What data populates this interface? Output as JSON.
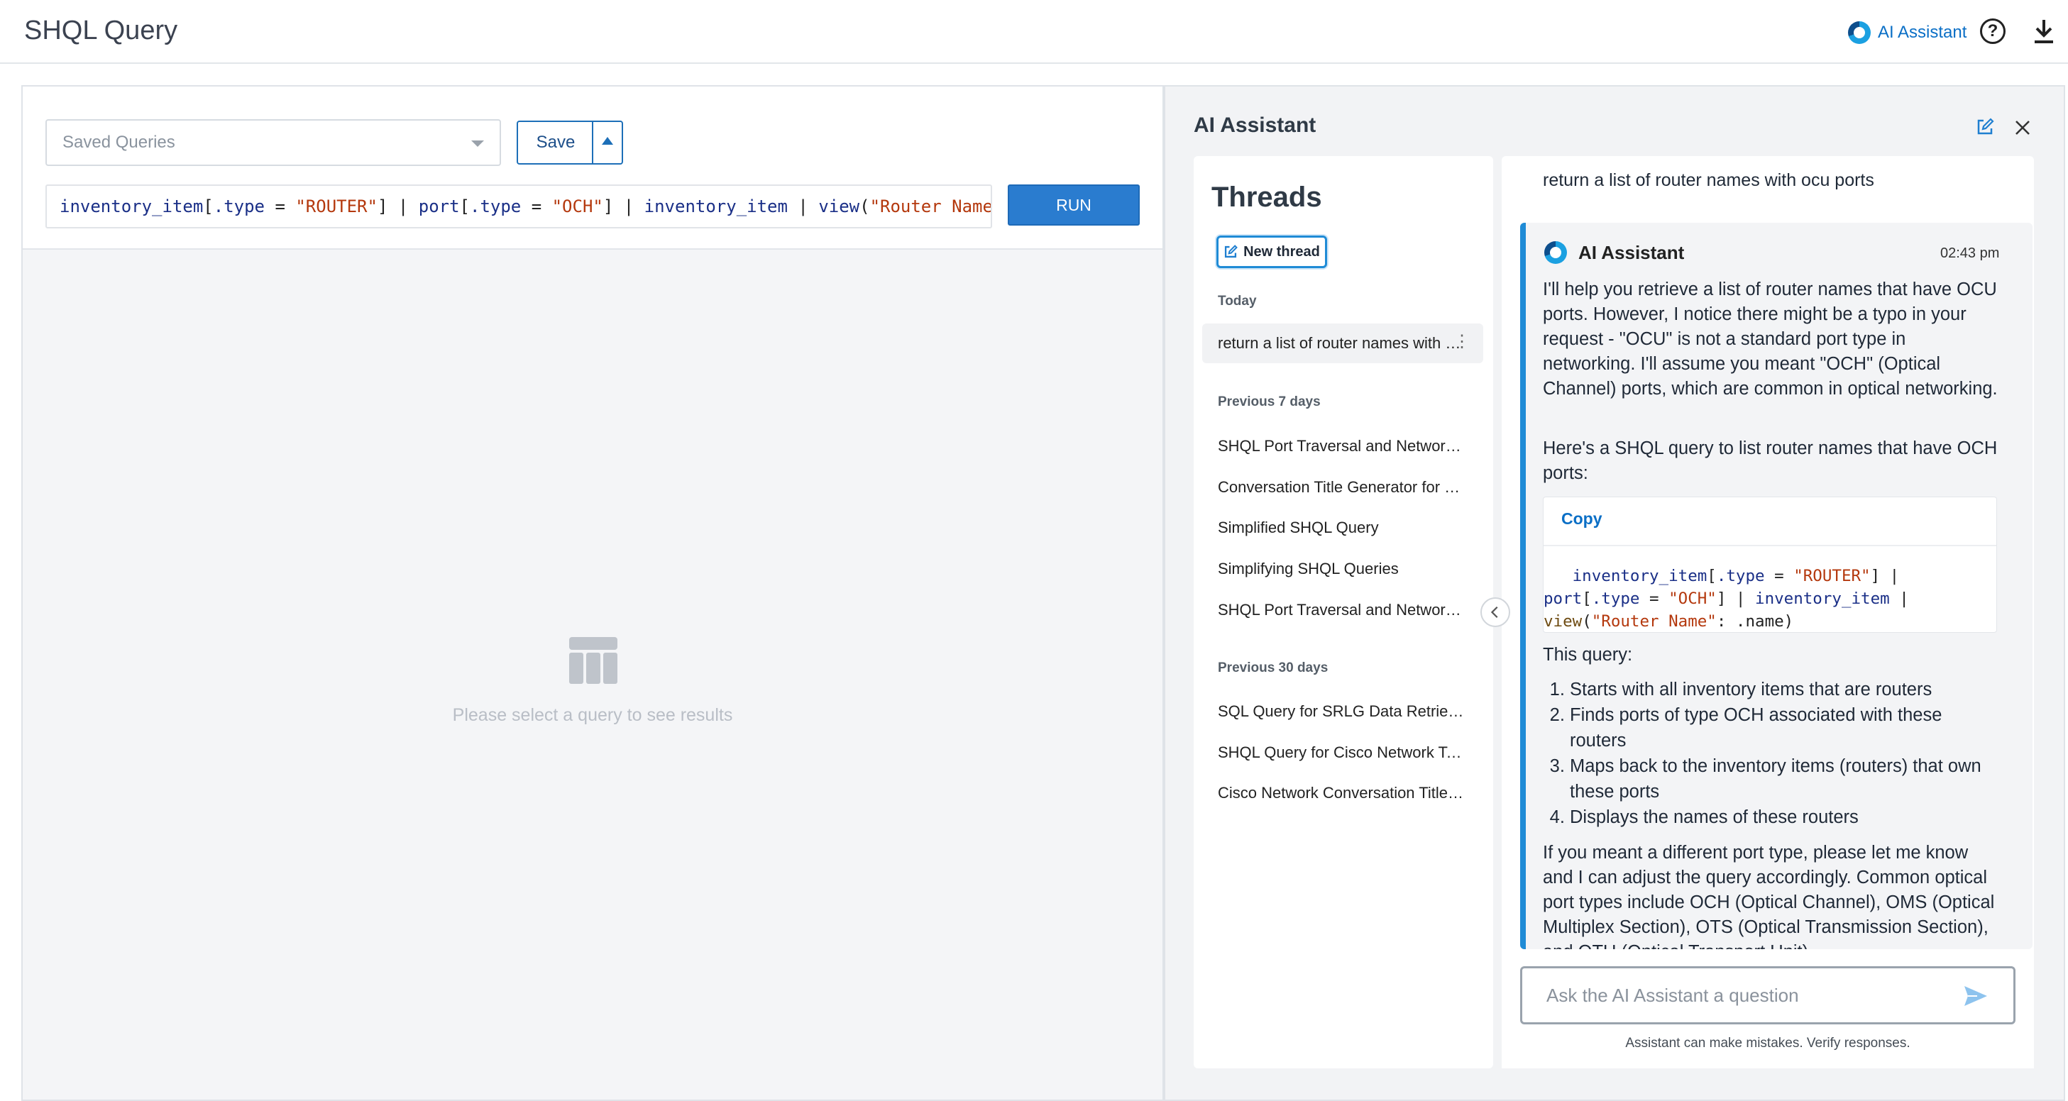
{
  "app": {
    "title": "SHQL Query",
    "ai_link": "AI Assistant"
  },
  "query": {
    "saved_placeholder": "Saved Queries",
    "save_label": "Save",
    "run_label": "RUN",
    "tokens": [
      {
        "t": "inventory_item",
        "c": "k-id"
      },
      {
        "t": "[",
        "c": "k-op"
      },
      {
        "t": ".type",
        "c": "k-id"
      },
      {
        "t": " = ",
        "c": "k-op"
      },
      {
        "t": "\"ROUTER\"",
        "c": "k-str"
      },
      {
        "t": "] | ",
        "c": "k-op"
      },
      {
        "t": "port",
        "c": "k-id"
      },
      {
        "t": "[",
        "c": "k-op"
      },
      {
        "t": ".type",
        "c": "k-id"
      },
      {
        "t": " = ",
        "c": "k-op"
      },
      {
        "t": "\"OCH\"",
        "c": "k-str"
      },
      {
        "t": "] | ",
        "c": "k-op"
      },
      {
        "t": "inventory_item",
        "c": "k-id"
      },
      {
        "t": " | ",
        "c": "k-op"
      },
      {
        "t": "view",
        "c": "k-id"
      },
      {
        "t": "(",
        "c": "k-op"
      },
      {
        "t": "\"Router Name\"",
        "c": "k-str"
      },
      {
        "t": ": ",
        "c": "k-op"
      },
      {
        "t": ".name",
        "c": "k-id"
      },
      {
        "t": ")",
        "c": "k-op"
      }
    ],
    "empty_message": "Please select a query to see results"
  },
  "assistant": {
    "panel_title": "AI Assistant",
    "threads": {
      "title": "Threads",
      "new_thread_label": "New thread",
      "today_label": "Today",
      "today": [
        "return a list of router names with ocu ports"
      ],
      "week_label": "Previous 7 days",
      "week": [
        "SHQL Port Traversal and Network Inventory",
        "Conversation Title Generator for Network",
        "Simplified SHQL Query",
        "Simplifying SHQL Queries",
        "SHQL Port Traversal and Network Inventory"
      ],
      "month_label": "Previous 30 days",
      "month": [
        "SQL Query for SRLG Data Retrieval",
        "SHQL Query for Cisco Network Topology",
        "Cisco Network Conversation Title Generator"
      ]
    },
    "chat": {
      "user_message": "return a list of router names with ocu ports",
      "response_author": "AI Assistant",
      "response_time": "02:43 pm",
      "para1": "I'll help you retrieve a list of router names that have OCU ports. However, I notice there might be a typo in your request - \"OCU\" is not a standard port type in networking. I'll assume you meant \"OCH\" (Optical Channel) ports, which are common in optical networking.",
      "para2": "Here's a SHQL query to list router names that have OCH ports:",
      "copy_label": "Copy",
      "code_lines": [
        [
          {
            "t": "   inventory_item",
            "c": "k-id"
          },
          {
            "t": "[",
            "c": "k-op"
          },
          {
            "t": ".type",
            "c": "k-id"
          },
          {
            "t": " = ",
            "c": "k-op"
          },
          {
            "t": "\"ROUTER\"",
            "c": "k-str"
          },
          {
            "t": "] |",
            "c": "k-op"
          }
        ],
        [
          {
            "t": "port",
            "c": "k-id"
          },
          {
            "t": "[",
            "c": "k-op"
          },
          {
            "t": ".type",
            "c": "k-id"
          },
          {
            "t": " = ",
            "c": "k-op"
          },
          {
            "t": "\"OCH\"",
            "c": "k-str"
          },
          {
            "t": "] | ",
            "c": "k-op"
          },
          {
            "t": "inventory_item",
            "c": "k-id"
          },
          {
            "t": " |",
            "c": "k-op"
          }
        ],
        [
          {
            "t": "view",
            "c": "k-fn"
          },
          {
            "t": "(",
            "c": "k-op"
          },
          {
            "t": "\"Router Name\"",
            "c": "k-str"
          },
          {
            "t": ": .name)",
            "c": "k-op"
          }
        ]
      ],
      "para3": "This query:",
      "steps": [
        "Starts with all inventory items that are routers",
        "Finds ports of type OCH associated with these routers",
        "Maps back to the inventory items (routers) that own these ports",
        "Displays the names of these routers"
      ],
      "para4": "If you meant a different port type, please let me know and I can adjust the query accordingly. Common optical port types include OCH (Optical Channel), OMS (Optical Multiplex Section), OTS (Optical Transmission Section), and OTU (Optical Transport Unit).",
      "input_placeholder": "Ask the AI Assistant a question",
      "disclaimer": "Assistant can make mistakes. Verify responses."
    }
  }
}
